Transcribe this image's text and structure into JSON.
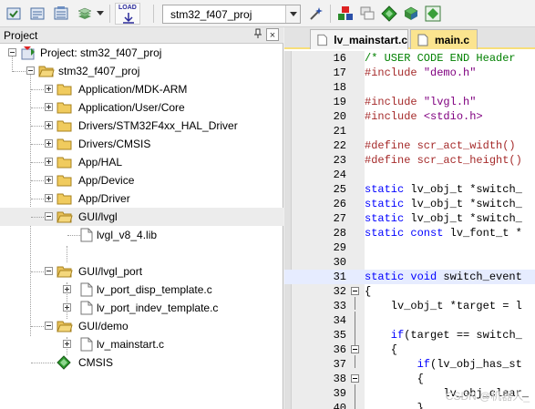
{
  "toolbar": {
    "buttons": [
      "translate-icon",
      "build-icon",
      "rebuild-icon",
      "batch-build-icon",
      "dropdown-arrow",
      "load-icon"
    ],
    "load_label": "LOAD",
    "target": "stm32_f407_proj",
    "right_buttons": [
      "wand-icon",
      "manage-components-icon",
      "window-layout-icon",
      "diamond-green-icon",
      "pack-installer-icon",
      "component-manager-icon"
    ]
  },
  "project_panel": {
    "title": "Project",
    "pin": "⊿",
    "close": "×",
    "root": "Project: stm32_f407_proj",
    "target": "stm32_f407_proj",
    "groups": [
      {
        "label": "Application/MDK-ARM"
      },
      {
        "label": "Application/User/Core"
      },
      {
        "label": "Drivers/STM32F4xx_HAL_Driver"
      },
      {
        "label": "Drivers/CMSIS"
      },
      {
        "label": "App/HAL"
      },
      {
        "label": "App/Device"
      },
      {
        "label": "App/Driver"
      },
      {
        "label": "GUI/lvgl"
      },
      {
        "label": "lvgl_v8_4.lib"
      },
      {
        "label": "GUI/lvgl_port"
      },
      {
        "label": "lv_port_disp_template.c"
      },
      {
        "label": "lv_port_indev_template.c"
      },
      {
        "label": "GUI/demo"
      },
      {
        "label": "lv_mainstart.c"
      },
      {
        "label": "CMSIS"
      }
    ]
  },
  "editor": {
    "tabs": [
      {
        "label": "lv_mainstart.c"
      },
      {
        "label": "main.c"
      }
    ],
    "lines": [
      {
        "n": "16"
      },
      {
        "n": "17"
      },
      {
        "n": "18"
      },
      {
        "n": "19"
      },
      {
        "n": "20"
      },
      {
        "n": "21"
      },
      {
        "n": "22"
      },
      {
        "n": "23"
      },
      {
        "n": "24"
      },
      {
        "n": "25"
      },
      {
        "n": "26"
      },
      {
        "n": "27"
      },
      {
        "n": "28"
      },
      {
        "n": "29"
      },
      {
        "n": "30"
      },
      {
        "n": "31"
      },
      {
        "n": "32"
      },
      {
        "n": "33"
      },
      {
        "n": "34"
      },
      {
        "n": "35"
      },
      {
        "n": "36"
      },
      {
        "n": "37"
      },
      {
        "n": "38"
      },
      {
        "n": "39"
      },
      {
        "n": "40"
      }
    ],
    "code": {
      "l16": "/* USER CODE END Header",
      "l17a": "#include",
      "l17b": "\"demo.h\"",
      "l19a": "#include",
      "l19b": "\"lvgl.h\"",
      "l20a": "#include",
      "l20b": "<stdio.h>",
      "l22": "#define scr_act_width() ",
      "l23": "#define scr_act_height()",
      "l25a": "static",
      "l25b": " lv_obj_t *switch_",
      "l26a": "static",
      "l26b": " lv_obj_t *switch_",
      "l27a": "static",
      "l27b": " lv_obj_t *switch_",
      "l28a": "static const",
      "l28b": " lv_font_t *",
      "l31a": "static void",
      "l31b": " switch_event",
      "l32": "{",
      "l33": "    lv_obj_t *target = l",
      "l35a": "    if",
      "l35b": "(target == switch_",
      "l36": "    {",
      "l37a": "        if",
      "l37b": "(lv_obj_has_st",
      "l38": "        {",
      "l39": "            lv_obj_clear_",
      "l40": "        }"
    },
    "watermark": "CSDN @机器人_"
  }
}
